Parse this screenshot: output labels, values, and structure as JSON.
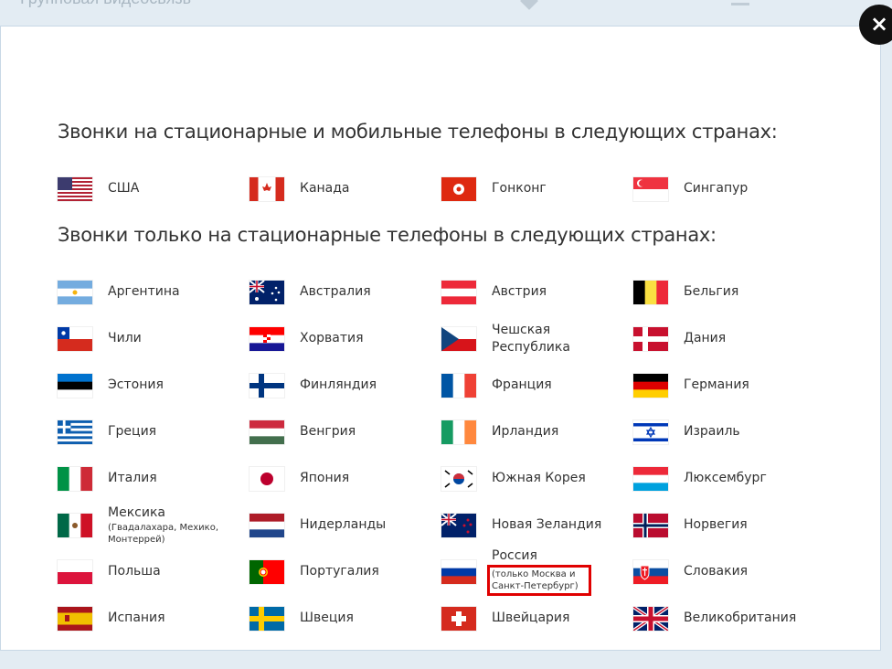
{
  "background": {
    "title": "Групповая видеосвязь"
  },
  "dialog": {
    "close_label": "×",
    "heading_mobile": "Звонки на стационарные и мобильные телефоны в следующих странах:",
    "heading_landline": "Звонки только на стационарные телефоны в следующих странах:",
    "mobile_countries": [
      {
        "name": "США",
        "flag": "us"
      },
      {
        "name": "Канада",
        "flag": "ca"
      },
      {
        "name": "Гонконг",
        "flag": "hk"
      },
      {
        "name": "Сингапур",
        "flag": "sg"
      }
    ],
    "landline_countries": [
      {
        "name": "Аргентина",
        "flag": "ar"
      },
      {
        "name": "Австралия",
        "flag": "au"
      },
      {
        "name": "Австрия",
        "flag": "at"
      },
      {
        "name": "Бельгия",
        "flag": "be"
      },
      {
        "name": "Чили",
        "flag": "cl"
      },
      {
        "name": "Хорватия",
        "flag": "hr"
      },
      {
        "name": "Чешская Республика",
        "flag": "cz"
      },
      {
        "name": "Дания",
        "flag": "dk"
      },
      {
        "name": "Эстония",
        "flag": "ee"
      },
      {
        "name": "Финляндия",
        "flag": "fi"
      },
      {
        "name": "Франция",
        "flag": "fr"
      },
      {
        "name": "Германия",
        "flag": "de"
      },
      {
        "name": "Греция",
        "flag": "gr"
      },
      {
        "name": "Венгрия",
        "flag": "hu"
      },
      {
        "name": "Ирландия",
        "flag": "ie"
      },
      {
        "name": "Израиль",
        "flag": "il"
      },
      {
        "name": "Италия",
        "flag": "it"
      },
      {
        "name": "Япония",
        "flag": "jp"
      },
      {
        "name": "Южная Корея",
        "flag": "kr"
      },
      {
        "name": "Люксембург",
        "flag": "lu"
      },
      {
        "name": "Мексика",
        "note": "(Гвадалахара, Мехико, Монтеррей)",
        "flag": "mx"
      },
      {
        "name": "Нидерланды",
        "flag": "nl"
      },
      {
        "name": "Новая Зеландия",
        "flag": "nz"
      },
      {
        "name": "Норвегия",
        "flag": "no"
      },
      {
        "name": "Польша",
        "flag": "pl"
      },
      {
        "name": "Португалия",
        "flag": "pt"
      },
      {
        "name": "Россия",
        "note": "(только Москва и Санкт-Петербург)",
        "highlight": true,
        "flag": "ru"
      },
      {
        "name": "Словакия",
        "flag": "sk"
      },
      {
        "name": "Испания",
        "flag": "es"
      },
      {
        "name": "Швеция",
        "flag": "se"
      },
      {
        "name": "Швейцария",
        "flag": "ch"
      },
      {
        "name": "Великобритания",
        "flag": "gb"
      }
    ]
  },
  "colors": {
    "highlight_border": "#e00000",
    "close_button": "#111111"
  }
}
